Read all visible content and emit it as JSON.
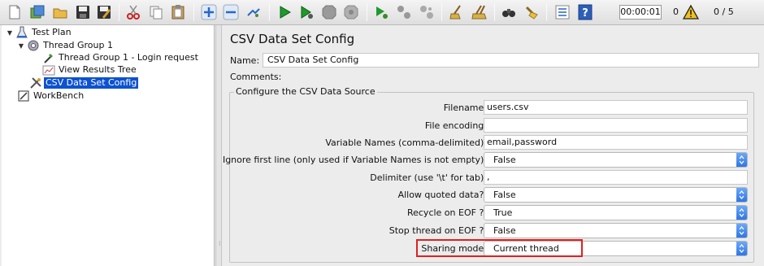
{
  "toolbar": {
    "buttons": [
      {
        "name": "new-icon"
      },
      {
        "name": "templates-icon"
      },
      {
        "name": "open-icon"
      },
      {
        "name": "save-icon"
      },
      {
        "name": "save-as-icon"
      },
      {
        "name": "cut-icon"
      },
      {
        "name": "copy-icon"
      },
      {
        "name": "paste-icon"
      },
      {
        "name": "expand-icon"
      },
      {
        "name": "collapse-icon"
      },
      {
        "name": "toggle-icon"
      },
      {
        "name": "start-icon"
      },
      {
        "name": "start-no-pause-icon"
      },
      {
        "name": "stop-icon"
      },
      {
        "name": "shutdown-icon"
      },
      {
        "name": "remote-start-icon"
      },
      {
        "name": "remote-stop-icon"
      },
      {
        "name": "remote-shutdown-icon"
      },
      {
        "name": "clear-icon"
      },
      {
        "name": "clear-all-icon"
      },
      {
        "name": "search-icon"
      },
      {
        "name": "reset-search-icon"
      },
      {
        "name": "function-helper-icon"
      },
      {
        "name": "help-icon"
      }
    ],
    "timer": "00:00:01",
    "error_count": "0",
    "threads": "0 / 5"
  },
  "tree": {
    "nodes": [
      {
        "label": "Test Plan",
        "icon": "flask-icon"
      },
      {
        "label": "Thread Group 1",
        "icon": "gear-icon"
      },
      {
        "label": "Thread Group 1 - Login request",
        "icon": "pipette-icon"
      },
      {
        "label": "View Results Tree",
        "icon": "chart-icon"
      },
      {
        "label": "CSV Data Set Config",
        "icon": "wrench-icon"
      },
      {
        "label": "WorkBench",
        "icon": "workbench-icon"
      }
    ]
  },
  "panel": {
    "title": "CSV Data Set Config",
    "name_label": "Name:",
    "name_value": "CSV Data Set Config",
    "comments_label": "Comments:",
    "group_title": "Configure the CSV Data Source",
    "fields": [
      {
        "label": "Filename:",
        "value": "users.csv",
        "kind": "text"
      },
      {
        "label": "File encoding:",
        "value": "",
        "kind": "text"
      },
      {
        "label": "Variable Names (comma-delimited):",
        "value": "email,password",
        "kind": "text"
      },
      {
        "label": "Ignore first line (only used if Variable Names is not empty):",
        "value": "False",
        "kind": "select"
      },
      {
        "label": "Delimiter (use '\\t' for tab):",
        "value": ",",
        "kind": "text"
      },
      {
        "label": "Allow quoted data?:",
        "value": "False",
        "kind": "select"
      },
      {
        "label": "Recycle on EOF ?:",
        "value": "True",
        "kind": "select"
      },
      {
        "label": "Stop thread on EOF ?:",
        "value": "False",
        "kind": "select"
      },
      {
        "label": "Sharing mode:",
        "value": "Current thread",
        "kind": "select"
      }
    ]
  },
  "colors": {
    "selection": "#0d52d0",
    "highlight": "#e02020",
    "select_stepper": "#2e76e8"
  }
}
